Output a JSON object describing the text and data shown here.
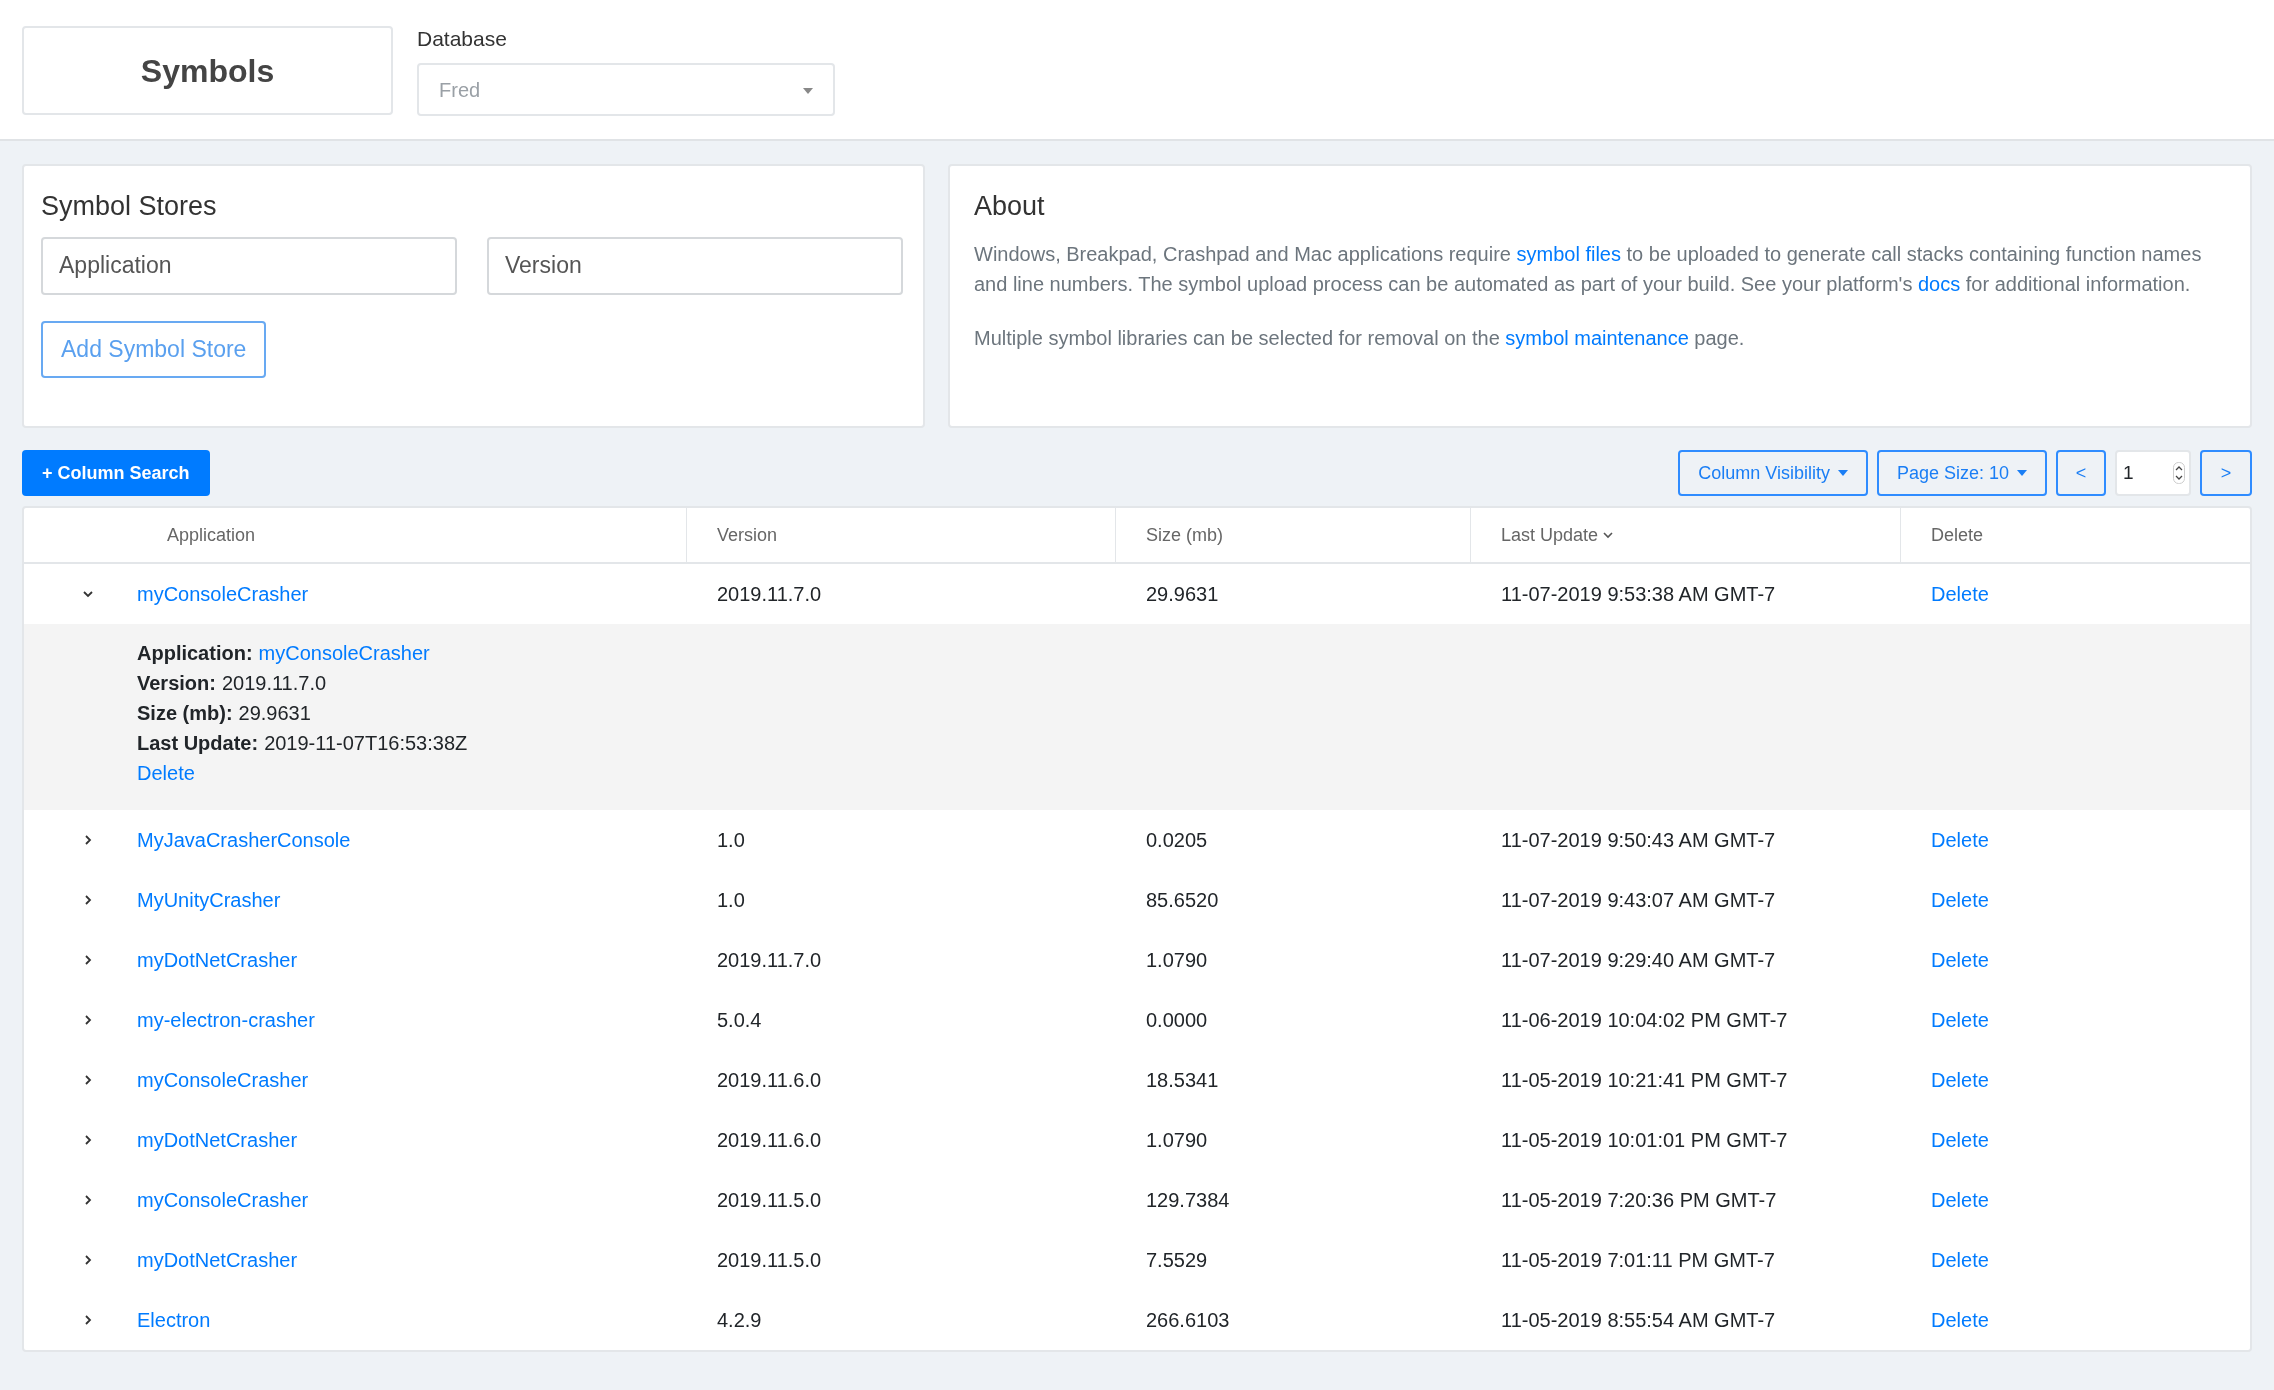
{
  "header": {
    "title": "Symbols",
    "database": {
      "label": "Database",
      "placeholder": "Fred"
    }
  },
  "symbol_stores": {
    "title": "Symbol Stores",
    "application": {
      "placeholder": "Application"
    },
    "version": {
      "placeholder": "Version"
    },
    "add_button": "Add Symbol Store"
  },
  "about": {
    "title": "About",
    "paragraphs": [
      [
        {
          "text": "Windows, Breakpad, Crashpad and Mac applications require "
        },
        {
          "text": "symbol files",
          "kind": "link"
        },
        {
          "text": " to be uploaded to generate call stacks containing function names and line numbers. The symbol upload process can be automated as part of your build. See your platform's "
        },
        {
          "text": "docs",
          "kind": "link"
        },
        {
          "text": " for additional information."
        }
      ],
      [
        {
          "text": "Multiple symbol libraries can be selected for removal on the "
        },
        {
          "text": "symbol maintenance",
          "kind": "link"
        },
        {
          "text": " page."
        }
      ]
    ]
  },
  "toolbar": {
    "column_search": "+ Column Search",
    "column_visibility": "Column Visibility",
    "page_size": "Page Size: 10",
    "prev": "<",
    "page": "1",
    "next": ">"
  },
  "table": {
    "columns": [
      {
        "label": "Application",
        "sorted": false
      },
      {
        "label": "Version",
        "sorted": false
      },
      {
        "label": "Size (mb)",
        "sorted": false
      },
      {
        "label": "Last Update",
        "sorted": true
      },
      {
        "label": "Delete",
        "sorted": false
      }
    ],
    "rows": [
      {
        "expanded": true,
        "application": "myConsoleCrasher",
        "version": "2019.11.7.0",
        "size": "29.9631",
        "last_update": "11-07-2019 9:53:38 AM GMT-7",
        "delete": "Delete",
        "details": [
          {
            "label": "Application:",
            "value": "myConsoleCrasher",
            "kind": "link"
          },
          {
            "label": "Version:",
            "value": "2019.11.7.0",
            "kind": "text"
          },
          {
            "label": "Size (mb):",
            "value": "29.9631",
            "kind": "text"
          },
          {
            "label": "Last Update:",
            "value": "2019-11-07T16:53:38Z",
            "kind": "text"
          }
        ],
        "details_delete": "Delete"
      },
      {
        "expanded": false,
        "application": "MyJavaCrasherConsole",
        "version": "1.0",
        "size": "0.0205",
        "last_update": "11-07-2019 9:50:43 AM GMT-7",
        "delete": "Delete"
      },
      {
        "expanded": false,
        "application": "MyUnityCrasher",
        "version": "1.0",
        "size": "85.6520",
        "last_update": "11-07-2019 9:43:07 AM GMT-7",
        "delete": "Delete"
      },
      {
        "expanded": false,
        "application": "myDotNetCrasher",
        "version": "2019.11.7.0",
        "size": "1.0790",
        "last_update": "11-07-2019 9:29:40 AM GMT-7",
        "delete": "Delete"
      },
      {
        "expanded": false,
        "application": "my-electron-crasher",
        "version": "5.0.4",
        "size": "0.0000",
        "last_update": "11-06-2019 10:04:02 PM GMT-7",
        "delete": "Delete"
      },
      {
        "expanded": false,
        "application": "myConsoleCrasher",
        "version": "2019.11.6.0",
        "size": "18.5341",
        "last_update": "11-05-2019 10:21:41 PM GMT-7",
        "delete": "Delete"
      },
      {
        "expanded": false,
        "application": "myDotNetCrasher",
        "version": "2019.11.6.0",
        "size": "1.0790",
        "last_update": "11-05-2019 10:01:01 PM GMT-7",
        "delete": "Delete"
      },
      {
        "expanded": false,
        "application": "myConsoleCrasher",
        "version": "2019.11.5.0",
        "size": "129.7384",
        "last_update": "11-05-2019 7:20:36 PM GMT-7",
        "delete": "Delete"
      },
      {
        "expanded": false,
        "application": "myDotNetCrasher",
        "version": "2019.11.5.0",
        "size": "7.5529",
        "last_update": "11-05-2019 7:01:11 PM GMT-7",
        "delete": "Delete"
      },
      {
        "expanded": false,
        "application": "Electron",
        "version": "4.2.9",
        "size": "266.6103",
        "last_update": "11-05-2019 8:55:54 AM GMT-7",
        "delete": "Delete"
      }
    ]
  }
}
